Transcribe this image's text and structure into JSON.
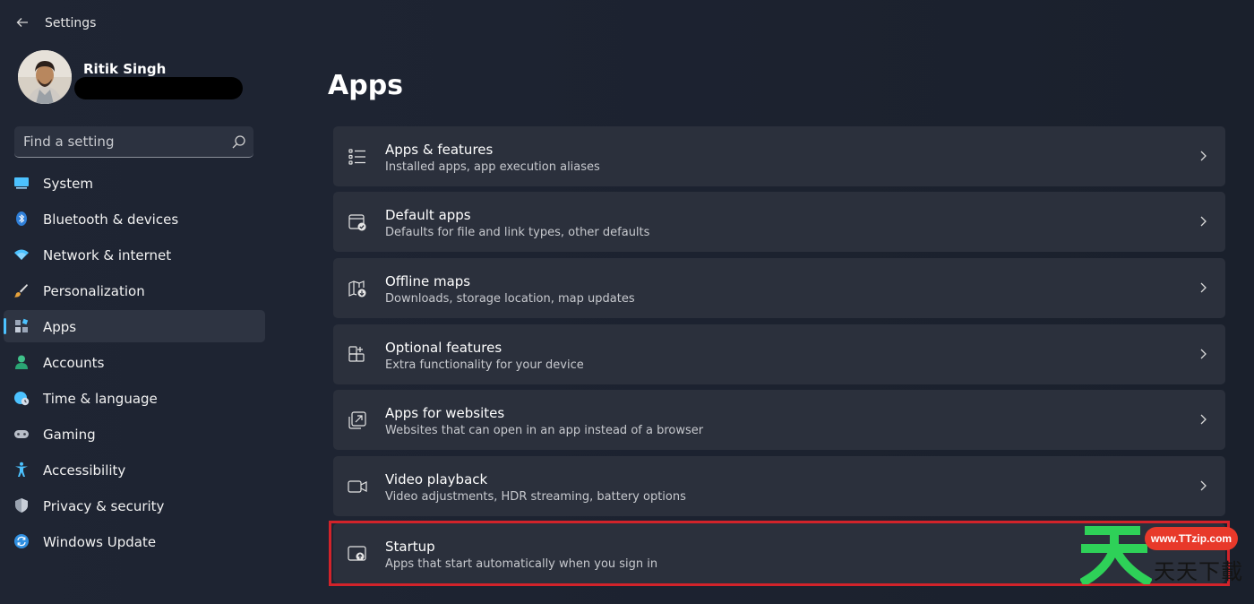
{
  "app": {
    "title": "Settings"
  },
  "profile": {
    "name": "Ritik Singh"
  },
  "search": {
    "placeholder": "Find a setting"
  },
  "sidebar": {
    "items": [
      {
        "label": "System",
        "icon": "monitor-icon",
        "active": false
      },
      {
        "label": "Bluetooth & devices",
        "icon": "bluetooth-icon",
        "active": false
      },
      {
        "label": "Network & internet",
        "icon": "wifi-icon",
        "active": false
      },
      {
        "label": "Personalization",
        "icon": "brush-icon",
        "active": false
      },
      {
        "label": "Apps",
        "icon": "apps-icon",
        "active": true
      },
      {
        "label": "Accounts",
        "icon": "person-icon",
        "active": false
      },
      {
        "label": "Time & language",
        "icon": "globe-clock-icon",
        "active": false
      },
      {
        "label": "Gaming",
        "icon": "gamepad-icon",
        "active": false
      },
      {
        "label": "Accessibility",
        "icon": "accessibility-icon",
        "active": false
      },
      {
        "label": "Privacy & security",
        "icon": "shield-icon",
        "active": false
      },
      {
        "label": "Windows Update",
        "icon": "sync-icon",
        "active": false
      }
    ]
  },
  "main": {
    "title": "Apps",
    "cards": [
      {
        "title": "Apps & features",
        "subtitle": "Installed apps, app execution aliases",
        "icon": "list-icon"
      },
      {
        "title": "Default apps",
        "subtitle": "Defaults for file and link types, other defaults",
        "icon": "default-apps-icon"
      },
      {
        "title": "Offline maps",
        "subtitle": "Downloads, storage location, map updates",
        "icon": "map-download-icon"
      },
      {
        "title": "Optional features",
        "subtitle": "Extra functionality for your device",
        "icon": "add-grid-icon"
      },
      {
        "title": "Apps for websites",
        "subtitle": "Websites that can open in an app instead of a browser",
        "icon": "open-window-icon"
      },
      {
        "title": "Video playback",
        "subtitle": "Video adjustments, HDR streaming, battery options",
        "icon": "video-camera-icon"
      },
      {
        "title": "Startup",
        "subtitle": "Apps that start automatically when you sign in",
        "icon": "startup-icon"
      }
    ],
    "highlighted_card": "Startup"
  },
  "watermark": {
    "badge": "www.TTzip.com",
    "text": "天天下載"
  },
  "colors": {
    "background": "#1f2533",
    "card": "#2b303c",
    "accent": "#4cc2ff",
    "highlight": "#d2232a"
  }
}
